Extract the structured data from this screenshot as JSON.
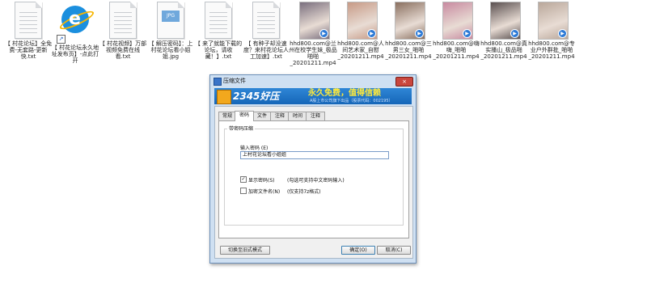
{
  "files": [
    {
      "name": "【 村花论坛】全免费-无套路-更新快.txt",
      "kind": "txt",
      "shortcut": false
    },
    {
      "name": "【 村花论坛永久地址发布页】-点此打开",
      "kind": "ie",
      "shortcut": true
    },
    {
      "name": "【 村花视频】万部视频免费在线看.txt",
      "kind": "txt",
      "shortcut": false
    },
    {
      "name": "【 解压密码】：上村花论坛看小姐姐.jpg",
      "kind": "jpg",
      "shortcut": false,
      "thumb_text": "JPG"
    },
    {
      "name": "【 来了就能下载的论坛，请收藏！】.txt",
      "kind": "txt",
      "shortcut": false
    },
    {
      "name": "【 有种子却没速度？来村花论坛人工加速】.txt",
      "kind": "txt",
      "shortcut": false
    },
    {
      "name": "hhd800.com@兰州在校学生妹_极品啪啪_20201211.mp4",
      "kind": "mp4",
      "color": "#7a6f7e"
    },
    {
      "name": "hhd800.com@人间艺术家_自慰_20201211.mp4",
      "kind": "mp4",
      "color": "#c79a86"
    },
    {
      "name": "hhd800.com@三男三女_啪啪_20201211.mp4",
      "kind": "mp4",
      "color": "#8a7060"
    },
    {
      "name": "hhd800.com@嗨嗨_啪啪_20201211.mp4",
      "kind": "mp4",
      "color": "#c88aa0"
    },
    {
      "name": "hhd800.com@真实播山_极品啪_20201211.mp4",
      "kind": "mp4",
      "color": "#5a5050"
    },
    {
      "name": "hhd800.com@专业户外群批_啪啪_20201211.mp4",
      "kind": "mp4",
      "color": "#b9a79a"
    }
  ],
  "dialog": {
    "title": "压缩文件",
    "close_icon": "×",
    "banner": {
      "brand": "2345好压",
      "slogan": "永久免费，值得信赖",
      "sub": "A股上市公司旗下出品（股票代码：002195）"
    },
    "tabs": [
      "常规",
      "密码",
      "文件",
      "注释",
      "时间",
      "注释"
    ],
    "active_tab": 1,
    "group_title": "带密码压缩",
    "password_label": "输入密码 (E)",
    "password_value": "上村花论坛看小姐姐",
    "show_password": {
      "label": "显示密码(S)",
      "hint": "(勾选可支持中文密码输入)",
      "checked": true
    },
    "encrypt_names": {
      "label": "加密文件名(N)",
      "hint": "(仅支持7z格式)",
      "checked": false
    },
    "switch_button": "切换至旧式模式",
    "ok_button": "确定(O)",
    "cancel_button": "取消(C)"
  },
  "colors": {
    "banner": "#1a6fc0",
    "slogan": "#ffe93a",
    "dialog_frame": "#cfe0f2"
  }
}
